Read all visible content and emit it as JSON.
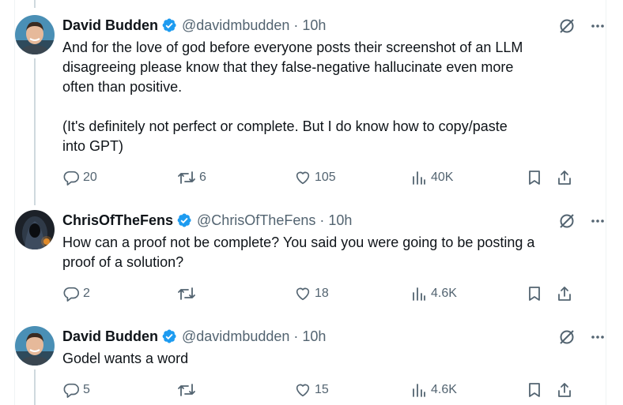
{
  "tweets": [
    {
      "name": "David Budden",
      "handle": "@davidmbudden",
      "time": "10h",
      "text": "And for the love of god before everyone posts their screenshot of an LLM\ndisagreeing please know that they false-negative hallucinate even more\noften than positive.\n\n(It's definitely not perfect or complete. But I do know how to copy/paste\ninto GPT)",
      "replies": "20",
      "reposts": "6",
      "likes": "105",
      "views": "40K"
    },
    {
      "name": "ChrisOfTheFens",
      "handle": "@ChrisOfTheFens",
      "time": "10h",
      "text": "How can a proof not be complete? You said you were going to be posting a\nproof of a solution?",
      "replies": "2",
      "reposts": "",
      "likes": "18",
      "views": "4.6K"
    },
    {
      "name": "David Budden",
      "handle": "@davidmbudden",
      "time": "10h",
      "text": "Godel wants a word",
      "replies": "5",
      "reposts": "",
      "likes": "15",
      "views": "4.6K"
    }
  ],
  "separator": "·",
  "colors": {
    "verified": "#1d9bf0",
    "muted": "#536471",
    "thread_line": "#cfd9de"
  },
  "icons": [
    "verified-badge-icon",
    "grok-icon",
    "more-icon",
    "reply-icon",
    "repost-icon",
    "like-icon",
    "views-icon",
    "bookmark-icon",
    "share-icon"
  ]
}
